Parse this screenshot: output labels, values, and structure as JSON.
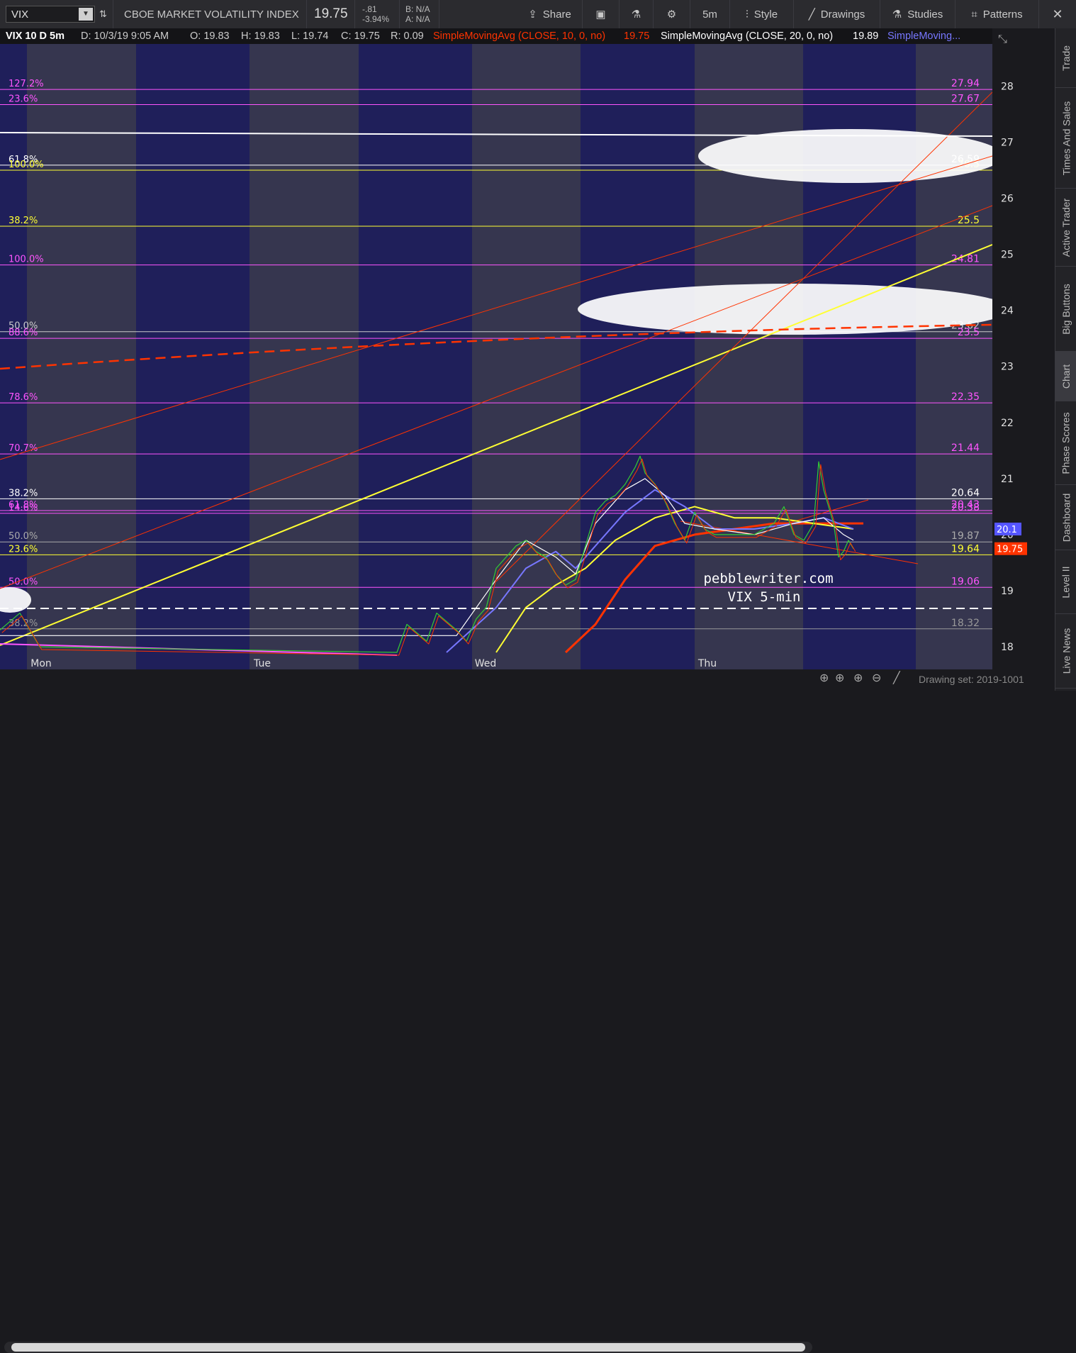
{
  "toolbar": {
    "symbol": "VIX",
    "description": "CBOE MARKET VOLATILITY INDEX",
    "last": "19.75",
    "net_change": "-.81",
    "pct_change": "-3.94%",
    "bid": "B: N/A",
    "ask": "A: N/A",
    "share": "Share",
    "timeframe": "5m",
    "style": "Style",
    "drawings": "Drawings",
    "studies": "Studies",
    "patterns": "Patterns"
  },
  "infobar": {
    "chart_label": "VIX 10 D 5m",
    "date": "D: 10/3/19 9:05 AM",
    "open": "O: 19.83",
    "high": "H: 19.83",
    "low": "L: 19.74",
    "close": "C: 19.75",
    "range": "R: 0.09",
    "study1": "SimpleMovingAvg (CLOSE, 10, 0, no)",
    "study1_value": "19.75",
    "study2": "SimpleMovingAvg (CLOSE, 20, 0, no)",
    "study2_value": "19.89",
    "study3": "SimpleMoving..."
  },
  "colors": {
    "background": "#1f1f5a",
    "band": "#36364f",
    "magenta": "#ff55ff",
    "yellow": "#ffff33",
    "red": "#ff3300",
    "white": "#ffffff",
    "blue": "#7777ff",
    "last_price_tag": "#ff3300",
    "sma20_tag": "#5555ff"
  },
  "chart_data": {
    "type": "line",
    "symbol": "VIX",
    "interval": "5m",
    "x_labels": [
      "Mon",
      "Tue",
      "Wed",
      "Thu"
    ],
    "ylim": [
      17.9,
      28.7
    ],
    "y_ticks": [
      18,
      19,
      20,
      21,
      22,
      23,
      24,
      25,
      26,
      27,
      28
    ],
    "last_price": 19.75,
    "sma_tag": 20.1,
    "annotation": [
      "pebblewriter.com",
      "VIX 5-min"
    ],
    "fib_levels": [
      {
        "pct": "127.2%",
        "value": 27.94,
        "color": "#ff55ff"
      },
      {
        "pct": "23.6%",
        "value": 27.67,
        "color": "#ff55ff"
      },
      {
        "pct": "61.8%",
        "value": 26.59,
        "color": "#ffffff"
      },
      {
        "pct": "100.0%",
        "value": 26.5,
        "color": "#ffff33"
      },
      {
        "pct": "38.2%",
        "value": 25.5,
        "color": "#ffff33"
      },
      {
        "pct": "100.0%",
        "value": 24.81,
        "color": "#ff55ff"
      },
      {
        "pct": "50.0%",
        "value": 23.62,
        "color": "#cccccc"
      },
      {
        "pct": "88.6%",
        "value": 23.5,
        "color": "#ff55ff"
      },
      {
        "pct": "78.6%",
        "value": 22.35,
        "color": "#ff55ff"
      },
      {
        "pct": "70.7%",
        "value": 21.44,
        "color": "#ff55ff"
      },
      {
        "pct": "38.2%",
        "value": 20.64,
        "color": "#ffffff"
      },
      {
        "pct": "61.8%",
        "value": 20.43,
        "color": "#ff55ff"
      },
      {
        "pct": "14.6%",
        "value": 20.38,
        "color": "#ff55ff"
      },
      {
        "pct": "50.0%",
        "value": 19.87,
        "color": "#aaaaaa"
      },
      {
        "pct": "23.6%",
        "value": 19.64,
        "color": "#ffff33"
      },
      {
        "pct": "50.0%",
        "value": 19.06,
        "color": "#ff55ff"
      },
      {
        "pct": "38.2%",
        "value": 18.32,
        "color": "#999999"
      }
    ],
    "price_path": [
      [
        0.0,
        18.3
      ],
      [
        0.02,
        18.6
      ],
      [
        0.04,
        18.0
      ],
      [
        0.4,
        17.9
      ],
      [
        0.41,
        18.4
      ],
      [
        0.43,
        18.1
      ],
      [
        0.44,
        18.6
      ],
      [
        0.46,
        18.3
      ],
      [
        0.47,
        18.1
      ],
      [
        0.48,
        18.5
      ],
      [
        0.49,
        18.7
      ],
      [
        0.5,
        19.4
      ],
      [
        0.51,
        19.6
      ],
      [
        0.52,
        19.8
      ],
      [
        0.53,
        19.9
      ],
      [
        0.54,
        19.7
      ],
      [
        0.55,
        19.6
      ],
      [
        0.56,
        19.3
      ],
      [
        0.57,
        19.1
      ],
      [
        0.58,
        19.2
      ],
      [
        0.59,
        19.8
      ],
      [
        0.6,
        20.4
      ],
      [
        0.61,
        20.6
      ],
      [
        0.62,
        20.7
      ],
      [
        0.63,
        20.9
      ],
      [
        0.64,
        21.2
      ],
      [
        0.645,
        21.4
      ],
      [
        0.65,
        21.1
      ],
      [
        0.66,
        20.9
      ],
      [
        0.67,
        20.6
      ],
      [
        0.68,
        20.2
      ],
      [
        0.69,
        19.9
      ],
      [
        0.7,
        20.4
      ],
      [
        0.71,
        20.1
      ],
      [
        0.72,
        20.0
      ],
      [
        0.74,
        20.0
      ],
      [
        0.76,
        20.0
      ],
      [
        0.78,
        20.2
      ],
      [
        0.79,
        20.5
      ],
      [
        0.8,
        20.0
      ],
      [
        0.81,
        19.9
      ],
      [
        0.82,
        20.2
      ],
      [
        0.825,
        21.3
      ],
      [
        0.83,
        20.8
      ],
      [
        0.84,
        20.2
      ],
      [
        0.845,
        19.6
      ],
      [
        0.85,
        19.7
      ],
      [
        0.855,
        19.9
      ],
      [
        0.86,
        19.75
      ]
    ],
    "sma10": [
      [
        0.0,
        18.2
      ],
      [
        0.46,
        18.2
      ],
      [
        0.5,
        19.2
      ],
      [
        0.53,
        19.9
      ],
      [
        0.56,
        19.6
      ],
      [
        0.58,
        19.3
      ],
      [
        0.6,
        20.2
      ],
      [
        0.63,
        20.8
      ],
      [
        0.65,
        21.0
      ],
      [
        0.67,
        20.7
      ],
      [
        0.69,
        20.2
      ],
      [
        0.72,
        20.1
      ],
      [
        0.76,
        20.0
      ],
      [
        0.8,
        20.2
      ],
      [
        0.83,
        20.3
      ],
      [
        0.85,
        20.0
      ],
      [
        0.86,
        19.9
      ]
    ],
    "sma20": [
      [
        0.45,
        17.9
      ],
      [
        0.5,
        18.7
      ],
      [
        0.53,
        19.4
      ],
      [
        0.56,
        19.7
      ],
      [
        0.58,
        19.4
      ],
      [
        0.6,
        19.8
      ],
      [
        0.63,
        20.4
      ],
      [
        0.66,
        20.8
      ],
      [
        0.69,
        20.5
      ],
      [
        0.72,
        20.1
      ],
      [
        0.76,
        20.1
      ],
      [
        0.8,
        20.2
      ],
      [
        0.83,
        20.3
      ],
      [
        0.86,
        20.1
      ]
    ],
    "sma_yellow": [
      [
        0.5,
        17.9
      ],
      [
        0.53,
        18.7
      ],
      [
        0.56,
        19.1
      ],
      [
        0.59,
        19.4
      ],
      [
        0.62,
        19.9
      ],
      [
        0.66,
        20.3
      ],
      [
        0.7,
        20.5
      ],
      [
        0.74,
        20.3
      ],
      [
        0.78,
        20.3
      ],
      [
        0.82,
        20.2
      ],
      [
        0.86,
        20.1
      ]
    ],
    "sma_red": [
      [
        0.57,
        17.9
      ],
      [
        0.6,
        18.4
      ],
      [
        0.63,
        19.2
      ],
      [
        0.66,
        19.8
      ],
      [
        0.7,
        20.0
      ],
      [
        0.74,
        20.1
      ],
      [
        0.78,
        20.2
      ],
      [
        0.82,
        20.2
      ],
      [
        0.87,
        20.2
      ]
    ]
  },
  "sidebar": {
    "tabs": [
      "Trade",
      "Times And Sales",
      "Active Trader",
      "Big Buttons",
      "Chart",
      "Phase Scores",
      "Dashboard",
      "Level II",
      "Live News"
    ]
  },
  "bottombar": {
    "drawing_set": "Drawing set: 2019-1001"
  }
}
